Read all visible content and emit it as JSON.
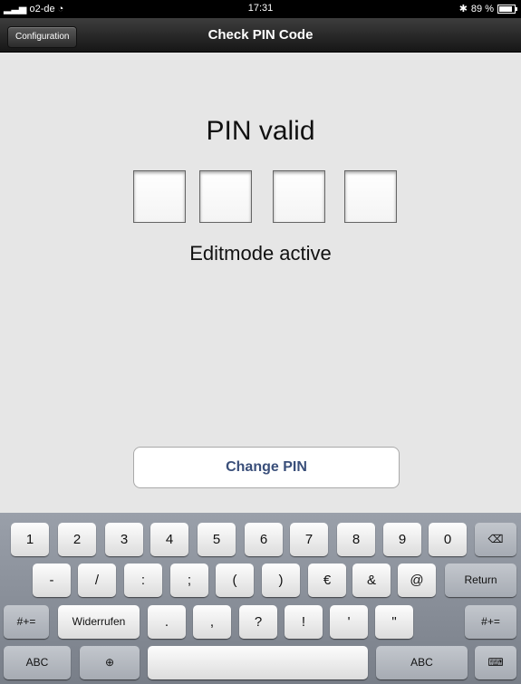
{
  "status_bar": {
    "carrier": "o2-de",
    "time": "17:31",
    "battery": "89 %"
  },
  "navbar": {
    "back_label": "Configuration",
    "title": "Check PIN Code"
  },
  "main": {
    "pin_status": "PIN valid",
    "pin_digits": [
      "",
      "",
      "",
      ""
    ],
    "edit_status": "Editmode active",
    "change_pin_label": "Change PIN"
  },
  "keyboard": {
    "row1": [
      "1",
      "2",
      "3",
      "4",
      "5",
      "6",
      "7",
      "8",
      "9",
      "0",
      "⌫"
    ],
    "row2": [
      "-",
      "/",
      ":",
      ";",
      "(",
      ")",
      "€",
      "&",
      "@",
      "Return"
    ],
    "row3": [
      "#+=",
      "Widerrufen",
      ".",
      ",",
      "?",
      "!",
      "'",
      "\"",
      "#+="
    ],
    "row4": [
      "ABC",
      "globe",
      "",
      "ABC",
      "hide-keyboard"
    ]
  }
}
